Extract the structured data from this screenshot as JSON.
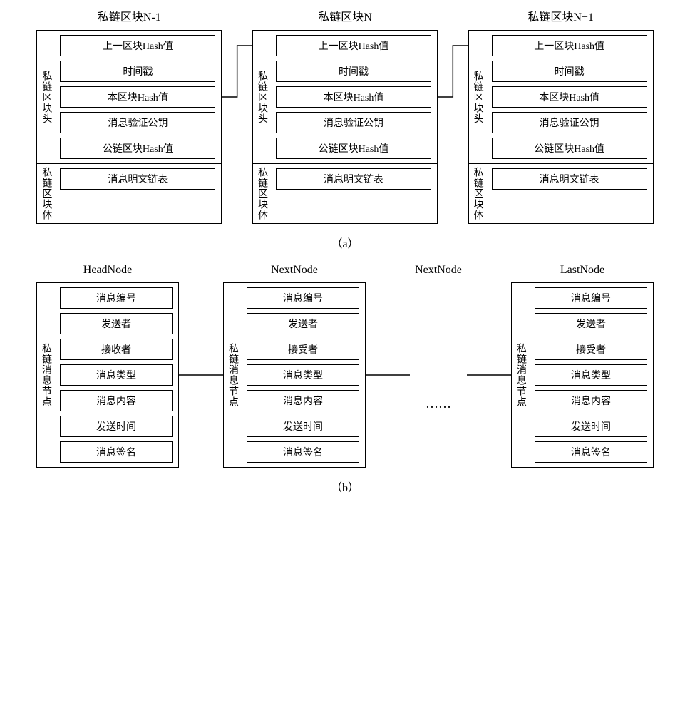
{
  "diagram_a": {
    "blocks": [
      {
        "title": "私链区块N-1",
        "header_label": "私链区块头",
        "body_label": "私链区块体",
        "header_fields": [
          "上一区块Hash值",
          "时间戳",
          "本区块Hash值",
          "消息验证公钥",
          "公链区块Hash值"
        ],
        "body_fields": [
          "消息明文链表"
        ]
      },
      {
        "title": "私链区块N",
        "header_label": "私链区块头",
        "body_label": "私链区块体",
        "header_fields": [
          "上一区块Hash值",
          "时间戳",
          "本区块Hash值",
          "消息验证公钥",
          "公链区块Hash值"
        ],
        "body_fields": [
          "消息明文链表"
        ]
      },
      {
        "title": "私链区块N+1",
        "header_label": "私链区块头",
        "body_label": "私链区块体",
        "header_fields": [
          "上一区块Hash值",
          "时间戳",
          "本区块Hash值",
          "消息验证公钥",
          "公链区块Hash值"
        ],
        "body_fields": [
          "消息明文链表"
        ]
      }
    ],
    "caption": "（a）"
  },
  "diagram_b": {
    "nodes": [
      {
        "title": "HeadNode",
        "side_label": "私链消息节点",
        "fields": [
          "消息编号",
          "发送者",
          "接收者",
          "消息类型",
          "消息内容",
          "发送时间",
          "消息签名"
        ]
      },
      {
        "title": "NextNode",
        "side_label": "私链消息节点",
        "fields": [
          "消息编号",
          "发送者",
          "接受者",
          "消息类型",
          "消息内容",
          "发送时间",
          "消息签名"
        ]
      },
      {
        "title": "NextNode",
        "side_label": "",
        "fields": [],
        "ellipsis": "……"
      },
      {
        "title": "LastNode",
        "side_label": "私链消息节点",
        "fields": [
          "消息编号",
          "发送者",
          "接受者",
          "消息类型",
          "消息内容",
          "发送时间",
          "消息签名"
        ]
      }
    ],
    "caption": "（b）"
  }
}
